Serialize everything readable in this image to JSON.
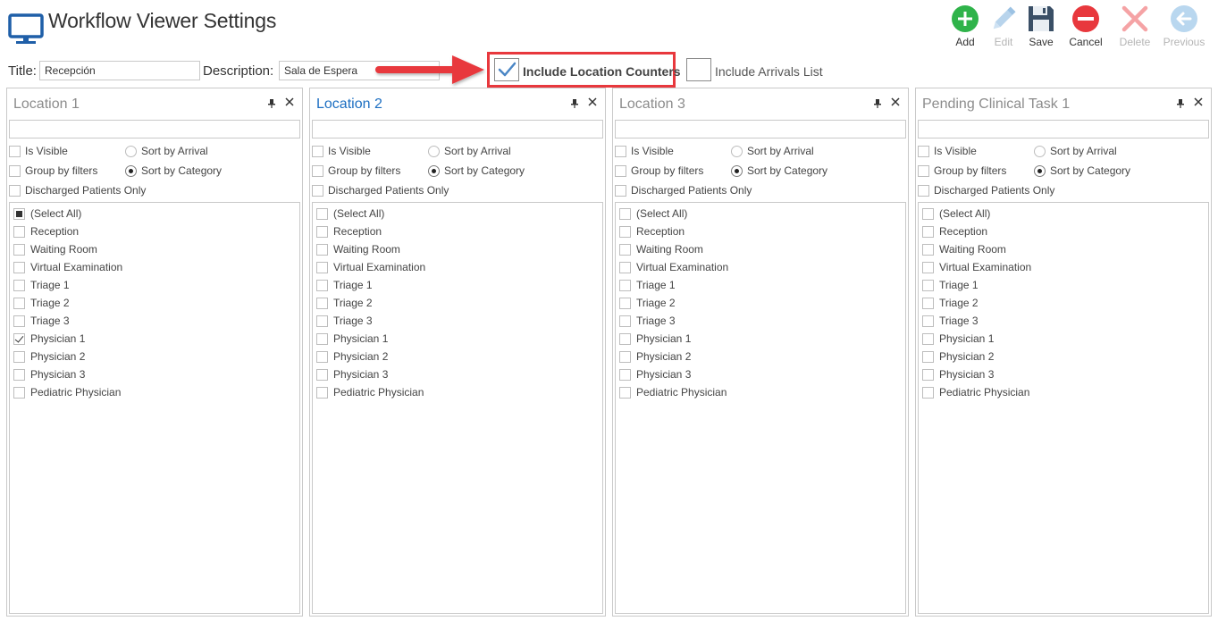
{
  "header": {
    "title": "Workflow Viewer Settings",
    "icon": "monitor-icon"
  },
  "toolbar": [
    {
      "id": "add",
      "label": "Add",
      "icon": "add-icon",
      "enabled": true,
      "color": "#2fb34a"
    },
    {
      "id": "edit",
      "label": "Edit",
      "icon": "edit-icon",
      "enabled": false,
      "color": "#a9cbe8"
    },
    {
      "id": "save",
      "label": "Save",
      "icon": "save-icon",
      "enabled": true,
      "color": "#3a4f66"
    },
    {
      "id": "cancel",
      "label": "Cancel",
      "icon": "cancel-icon",
      "enabled": true,
      "color": "#e8383d"
    },
    {
      "id": "delete",
      "label": "Delete",
      "icon": "delete-icon",
      "enabled": false,
      "color": "#f3a6a8"
    },
    {
      "id": "previous",
      "label": "Previous",
      "icon": "previous-icon",
      "enabled": false,
      "color": "#a9cbe8"
    }
  ],
  "form": {
    "title_label": "Title:",
    "title_value": "Recepción",
    "description_label": "Description:",
    "description_value": "Sala de Espera",
    "include_location_counters": {
      "label": "Include Location Counters",
      "checked": true
    },
    "include_arrivals_list": {
      "label": "Include Arrivals List",
      "checked": false
    }
  },
  "annotation": {
    "arrow_color": "#e8383d",
    "highlight_color": "#e8383d"
  },
  "panels": [
    {
      "title": "Location 1",
      "active": false,
      "is_visible": "Is Visible",
      "group_by_filters": "Group by filters",
      "discharged_only": "Discharged Patients Only",
      "sort_by_arrival": "Sort by Arrival",
      "sort_by_category": "Sort by Category",
      "sort_selected": "category",
      "items": [
        {
          "label": "(Select All)",
          "state": "indeterminate"
        },
        {
          "label": "Reception",
          "state": "unchecked"
        },
        {
          "label": "Waiting Room",
          "state": "unchecked"
        },
        {
          "label": "Virtual Examination",
          "state": "unchecked"
        },
        {
          "label": "Triage 1",
          "state": "unchecked"
        },
        {
          "label": "Triage 2",
          "state": "unchecked"
        },
        {
          "label": "Triage 3",
          "state": "unchecked"
        },
        {
          "label": "Physician 1",
          "state": "checked"
        },
        {
          "label": "Physician 2",
          "state": "unchecked"
        },
        {
          "label": "Physician 3",
          "state": "unchecked"
        },
        {
          "label": "Pediatric Physician",
          "state": "unchecked"
        }
      ]
    },
    {
      "title": "Location 2",
      "active": true,
      "is_visible": "Is Visible",
      "group_by_filters": "Group by filters",
      "discharged_only": "Discharged Patients Only",
      "sort_by_arrival": "Sort by Arrival",
      "sort_by_category": "Sort by Category",
      "sort_selected": "category",
      "items": [
        {
          "label": "(Select All)",
          "state": "unchecked"
        },
        {
          "label": "Reception",
          "state": "unchecked"
        },
        {
          "label": "Waiting Room",
          "state": "unchecked"
        },
        {
          "label": "Virtual Examination",
          "state": "unchecked"
        },
        {
          "label": "Triage 1",
          "state": "unchecked"
        },
        {
          "label": "Triage 2",
          "state": "unchecked"
        },
        {
          "label": "Triage 3",
          "state": "unchecked"
        },
        {
          "label": "Physician 1",
          "state": "unchecked"
        },
        {
          "label": "Physician 2",
          "state": "unchecked"
        },
        {
          "label": "Physician 3",
          "state": "unchecked"
        },
        {
          "label": "Pediatric Physician",
          "state": "unchecked"
        }
      ]
    },
    {
      "title": "Location 3",
      "active": false,
      "is_visible": "Is Visible",
      "group_by_filters": "Group by filters",
      "discharged_only": "Discharged Patients Only",
      "sort_by_arrival": "Sort by Arrival",
      "sort_by_category": "Sort by Category",
      "sort_selected": "category",
      "items": [
        {
          "label": "(Select All)",
          "state": "unchecked"
        },
        {
          "label": "Reception",
          "state": "unchecked"
        },
        {
          "label": "Waiting Room",
          "state": "unchecked"
        },
        {
          "label": "Virtual Examination",
          "state": "unchecked"
        },
        {
          "label": "Triage 1",
          "state": "unchecked"
        },
        {
          "label": "Triage 2",
          "state": "unchecked"
        },
        {
          "label": "Triage 3",
          "state": "unchecked"
        },
        {
          "label": "Physician 1",
          "state": "unchecked"
        },
        {
          "label": "Physician 2",
          "state": "unchecked"
        },
        {
          "label": "Physician 3",
          "state": "unchecked"
        },
        {
          "label": "Pediatric Physician",
          "state": "unchecked"
        }
      ]
    },
    {
      "title": "Pending Clinical Task 1",
      "active": false,
      "is_visible": "Is Visible",
      "group_by_filters": "Group by filters",
      "discharged_only": "Discharged Patients Only",
      "sort_by_arrival": "Sort by Arrival",
      "sort_by_category": "Sort by Category",
      "sort_selected": "category",
      "items": [
        {
          "label": "(Select All)",
          "state": "unchecked"
        },
        {
          "label": "Reception",
          "state": "unchecked"
        },
        {
          "label": "Waiting Room",
          "state": "unchecked"
        },
        {
          "label": "Virtual Examination",
          "state": "unchecked"
        },
        {
          "label": "Triage 1",
          "state": "unchecked"
        },
        {
          "label": "Triage 2",
          "state": "unchecked"
        },
        {
          "label": "Triage 3",
          "state": "unchecked"
        },
        {
          "label": "Physician 1",
          "state": "unchecked"
        },
        {
          "label": "Physician 2",
          "state": "unchecked"
        },
        {
          "label": "Physician 3",
          "state": "unchecked"
        },
        {
          "label": "Pediatric Physician",
          "state": "unchecked"
        }
      ]
    }
  ]
}
